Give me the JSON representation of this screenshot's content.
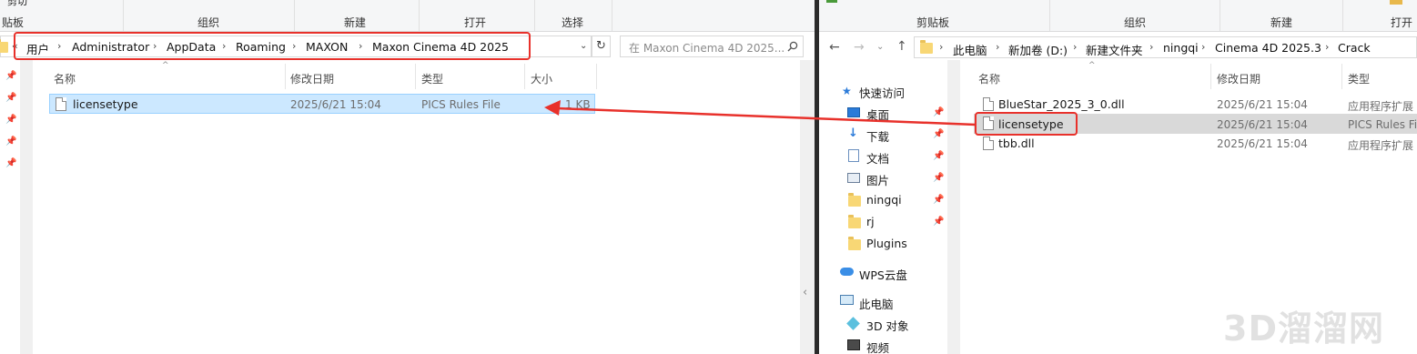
{
  "left": {
    "ribbon": {
      "top_clipped": [
        "剪切",
        "",
        "",
        ""
      ],
      "groups": [
        "贴板",
        "组织",
        "新建",
        "打开",
        "选择"
      ]
    },
    "address": {
      "crumbs": [
        "用户",
        "Administrator",
        "AppData",
        "Roaming",
        "MAXON",
        "Maxon Cinema 4D 2025"
      ],
      "search_placeholder": "在 Maxon Cinema 4D 2025..."
    },
    "columns": [
      "名称",
      "修改日期",
      "类型",
      "大小"
    ],
    "files": [
      {
        "name": "licensetype",
        "date": "2025/6/21 15:04",
        "type": "PICS Rules File",
        "size": "1 KB"
      }
    ]
  },
  "right": {
    "ribbon": {
      "groups": [
        "剪贴板",
        "组织",
        "新建",
        "打开"
      ]
    },
    "address": {
      "crumbs": [
        "此电脑",
        "新加卷 (D:)",
        "新建文件夹",
        "ningqi",
        "Cinema 4D 2025.3",
        "Crack"
      ]
    },
    "columns": [
      "名称",
      "修改日期",
      "类型"
    ],
    "files": [
      {
        "name": "BlueStar_2025_3_0.dll",
        "date": "2025/6/21 15:04",
        "type": "应用程序扩展"
      },
      {
        "name": "licensetype",
        "date": "2025/6/21 15:04",
        "type": "PICS Rules File"
      },
      {
        "name": "tbb.dll",
        "date": "2025/6/21 15:04",
        "type": "应用程序扩展"
      }
    ],
    "nav": {
      "quick_access": "快速访问",
      "items": [
        "桌面",
        "下载",
        "文档",
        "图片",
        "ningqi",
        "rj",
        "Plugins"
      ],
      "wps": "WPS云盘",
      "this_pc": "此电脑",
      "pc_items": [
        "3D 对象",
        "视频"
      ]
    }
  },
  "watermark": "3D溜溜网",
  "colors": {
    "accent": "#cce8ff",
    "highlight": "#e8312b",
    "selected_gray": "#d9d9d9"
  }
}
